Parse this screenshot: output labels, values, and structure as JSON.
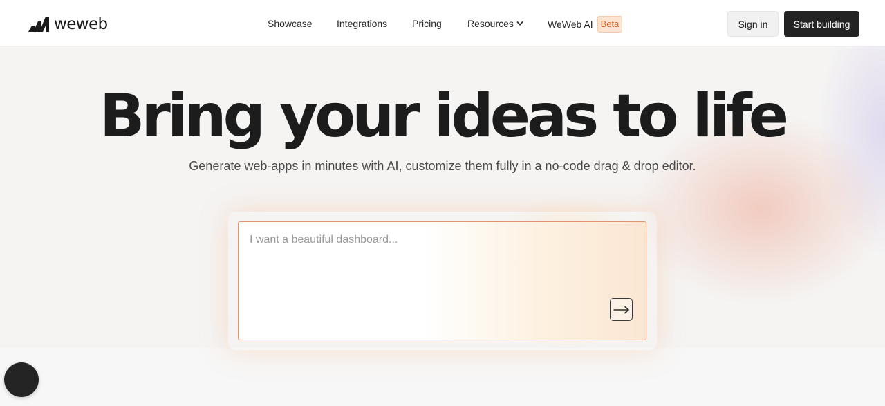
{
  "header": {
    "brand": "weweb",
    "nav": [
      {
        "label": "Showcase"
      },
      {
        "label": "Integrations"
      },
      {
        "label": "Pricing"
      },
      {
        "label": "Resources"
      },
      {
        "label": "WeWeb AI",
        "badge": "Beta"
      }
    ],
    "sign_in_label": "Sign in",
    "start_label": "Start building"
  },
  "hero": {
    "title": "Bring your ideas to life",
    "subtitle": "Generate web-apps in minutes with AI, customize them fully in a no-code drag & drop editor."
  },
  "prompt": {
    "placeholder": "I want a beautiful dashboard...",
    "value": ""
  },
  "icons": {
    "logo": "weweb-logo-icon",
    "resources_chevron": "chevron-down-icon",
    "submit": "arrow-right-icon",
    "chat": "chat-launcher-icon"
  },
  "colors": {
    "primary_button": "#232323",
    "beta_badge_bg": "#fde4d2",
    "beta_badge_text": "#d9622b",
    "prompt_border": "#e29470"
  }
}
